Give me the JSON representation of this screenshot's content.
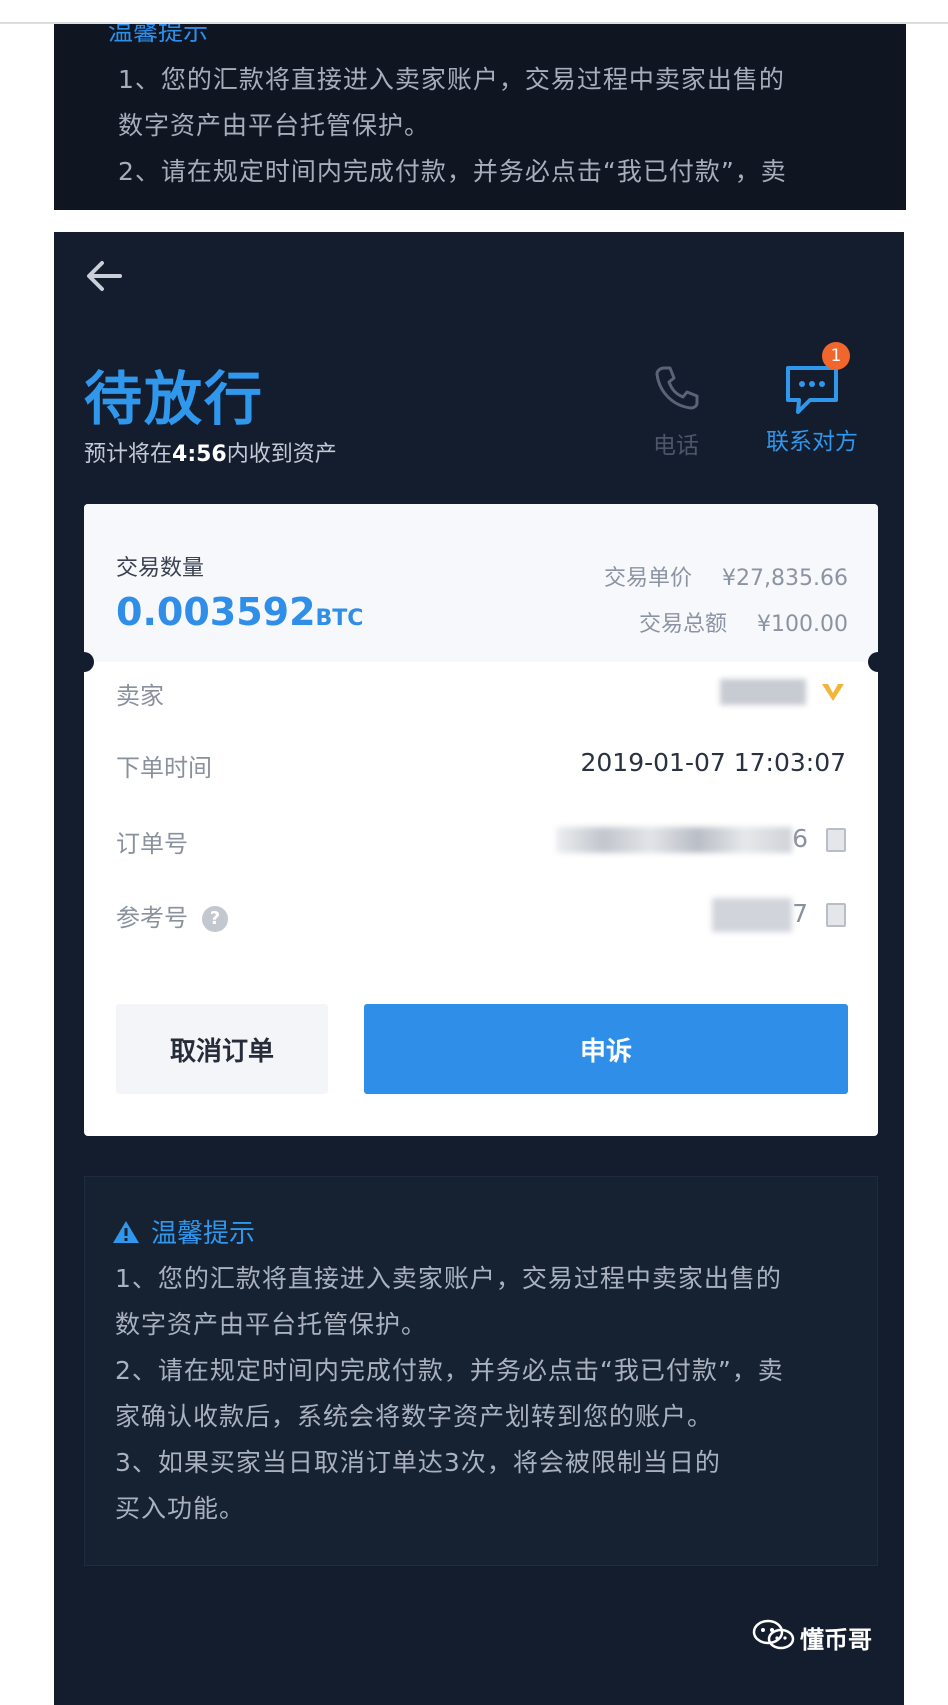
{
  "strip": {
    "title": "温馨提示",
    "lines": [
      "1、您的汇款将直接进入卖家账户，交易过程中卖家出售的",
      "数字资产由平台托管保护。",
      "2、请在规定时间内完成付款，并务必点击“我已付款”，卖"
    ]
  },
  "header": {
    "status": "待放行",
    "eta_prefix": "预计将在",
    "eta_time": "4:56",
    "eta_suffix": "内收到资产",
    "phone_label": "电话",
    "chat_label": "联系对方",
    "chat_badge": "1"
  },
  "order": {
    "qty_label": "交易数量",
    "qty_value": "0.003592",
    "qty_unit": "BTC",
    "unit_price_label": "交易单价",
    "unit_price": "¥27,835.66",
    "total_label": "交易总额",
    "total": "¥100.00",
    "seller_label": "卖家",
    "time_label": "下单时间",
    "time_value": "2019-01-07 17:03:07",
    "order_no_label": "订单号",
    "order_no_tail": "6",
    "ref_no_label": "参考号",
    "ref_no_tail": "7",
    "help_glyph": "?"
  },
  "buttons": {
    "cancel": "取消订单",
    "appeal": "申诉"
  },
  "tips": {
    "title": "温馨提示",
    "lines": [
      "1、您的汇款将直接进入卖家账户，交易过程中卖家出售的",
      "数字资产由平台托管保护。",
      "2、请在规定时间内完成付款，并务必点击“我已付款”，卖",
      "家确认收款后，系统会将数字资产划转到您的账户。",
      "3、如果买家当日取消订单达3次，将会被限制当日的",
      "买入功能。"
    ]
  },
  "watermark": "懂币哥",
  "colors": {
    "accent": "#2f8ee8",
    "background": "#141d2e",
    "badge": "#f0662c",
    "vip": "#f2b53a"
  }
}
